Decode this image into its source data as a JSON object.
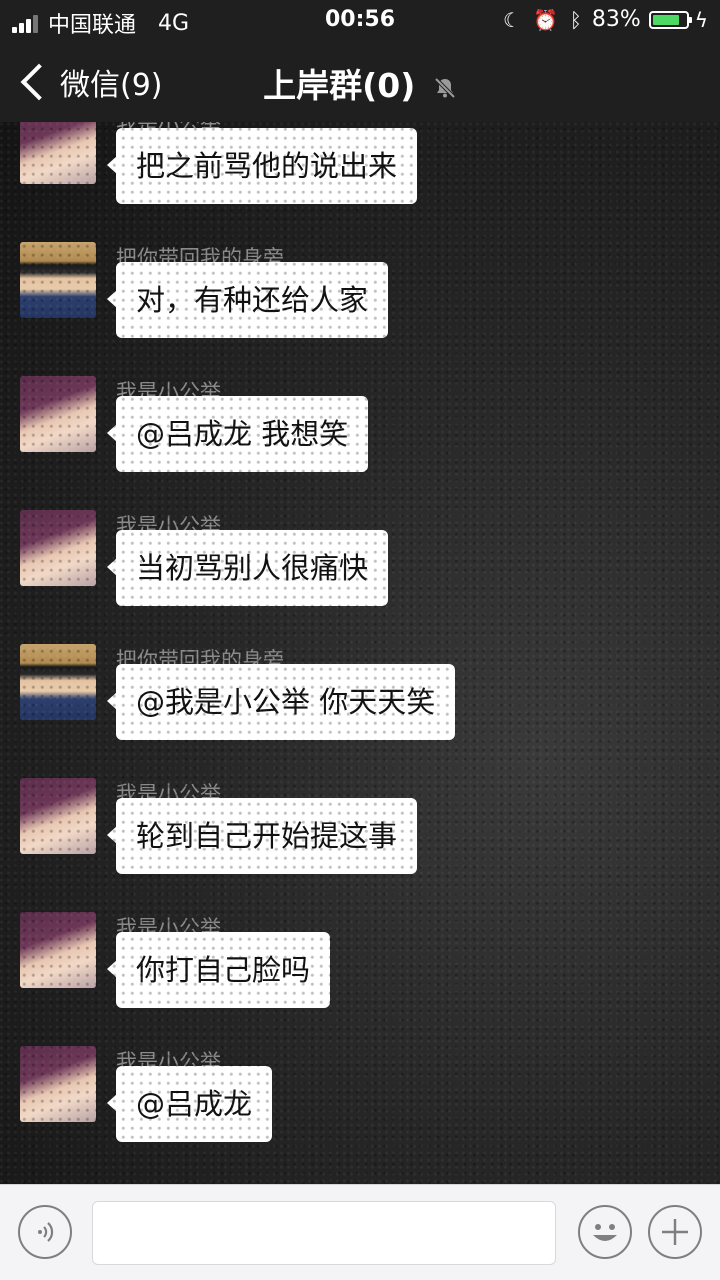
{
  "status_bar": {
    "carrier": "中国联通",
    "network": "4G",
    "time": "00:56",
    "battery_percent": "83%",
    "battery_level": 0.83,
    "icons": [
      "signal-icon",
      "moon-icon",
      "alarm-icon",
      "bluetooth-icon",
      "battery-icon",
      "charging-icon"
    ]
  },
  "nav": {
    "back_label": "微信(9)",
    "title": "上岸群(0)",
    "icons": [
      "back-chevron-icon",
      "mute-icon"
    ]
  },
  "messages": [
    {
      "sender": "我是小公举",
      "text": "把之前骂他的说出来",
      "avatar": "girl"
    },
    {
      "sender": "把你带回我的身旁",
      "text": "对，有种还给人家",
      "avatar": "boy"
    },
    {
      "sender": "我是小公举",
      "text": "@吕成龙 我想笑",
      "avatar": "girl"
    },
    {
      "sender": "我是小公举",
      "text": "当初骂别人很痛快",
      "avatar": "girl"
    },
    {
      "sender": "把你带回我的身旁",
      "text": "@我是小公举 你天天笑",
      "avatar": "boy"
    },
    {
      "sender": "我是小公举",
      "text": "轮到自己开始提这事",
      "avatar": "girl"
    },
    {
      "sender": "我是小公举",
      "text": "你打自己脸吗",
      "avatar": "girl"
    },
    {
      "sender": "我是小公举",
      "text": "@吕成龙",
      "avatar": "girl"
    }
  ],
  "input_bar": {
    "input_value": "",
    "icons": [
      "voice-icon",
      "emoji-icon",
      "plus-icon"
    ]
  },
  "colors": {
    "bar_background": "#1f1f1f",
    "bubble": "#ffffff",
    "battery_fill": "#4cd964",
    "sender_name": "#8a8a8a"
  }
}
